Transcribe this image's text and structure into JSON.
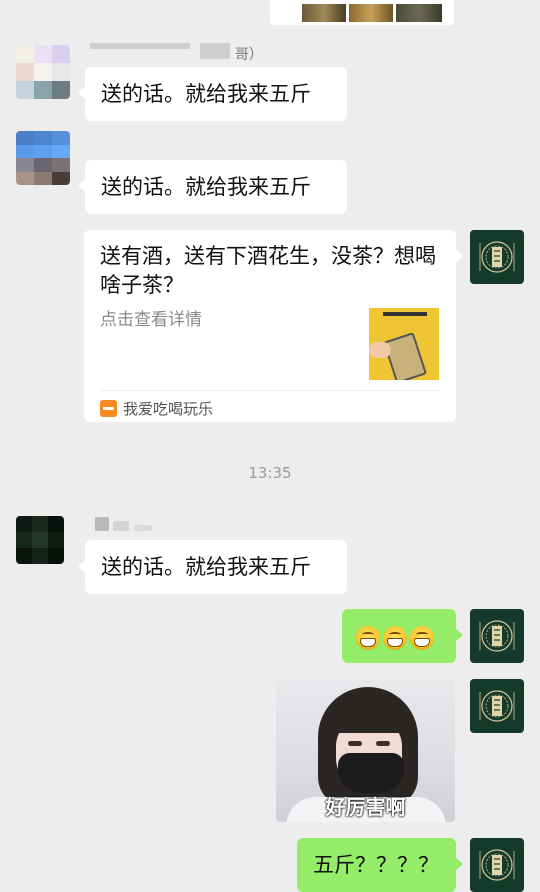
{
  "chat": {
    "top_partial_name": "哥）",
    "msg1": "送的话。就给我来五斤",
    "msg2": "送的话。就给我来五斤",
    "card": {
      "title": "送有酒，送有下酒花生，没茶？想喝啥子茶？",
      "desc": "点击查看详情",
      "source_icon": "mini-program-icon",
      "source": "我爱吃喝玩乐"
    },
    "timestamp": "13:35",
    "msg3": "送的话。就给我来五斤",
    "emoji_msg": "grinning-face-x3",
    "image_caption": "好厉害啊",
    "last_msg": "五斤？？？？"
  },
  "colors": {
    "background": "#ededed",
    "bubble_left": "#ffffff",
    "bubble_right": "#95ec69",
    "tea_avatar": "#143a2c"
  }
}
